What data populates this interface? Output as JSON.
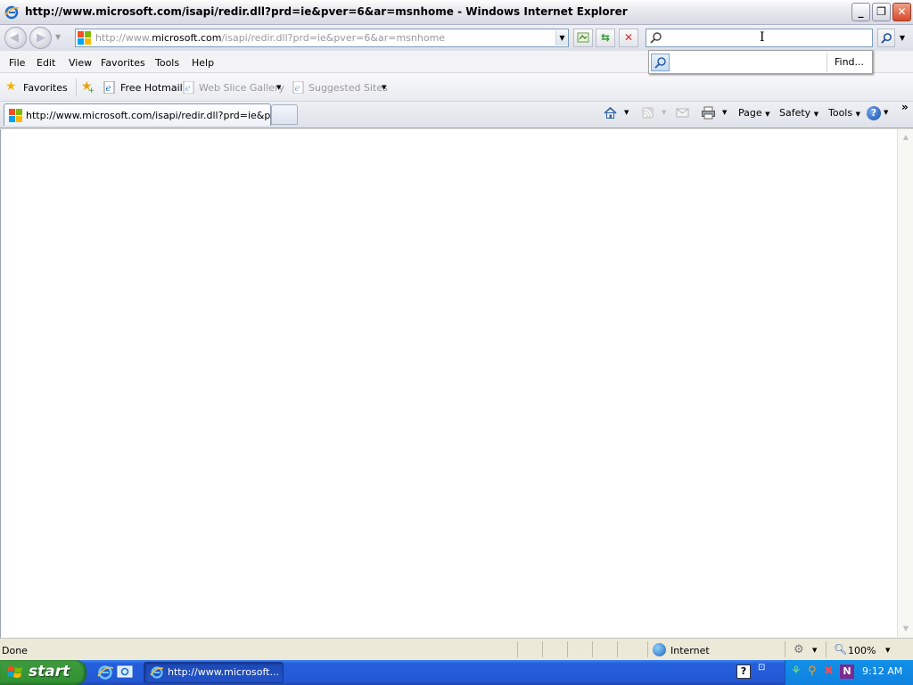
{
  "window": {
    "title": "http://www.microsoft.com/isapi/redir.dll?prd=ie&pver=6&ar=msnhome - Windows Internet Explorer"
  },
  "address": {
    "url_prefix": "http://www.",
    "url_host": "microsoft.com",
    "url_path": "/isapi/redir.dll?prd=ie&pver=6&ar=msnhome"
  },
  "search": {
    "value": "",
    "popup_find": "Find..."
  },
  "menu": {
    "items": [
      "File",
      "Edit",
      "View",
      "Favorites",
      "Tools",
      "Help"
    ]
  },
  "favorites_bar": {
    "favorites_label": "Favorites",
    "links": [
      "Free Hotmail",
      "Web Slice Gallery",
      "Suggested Sites"
    ]
  },
  "tab": {
    "label": "http://www.microsoft.com/isapi/redir.dll?prd=ie&pver..."
  },
  "command_bar": {
    "page": "Page",
    "safety": "Safety",
    "tools": "Tools"
  },
  "status": {
    "text": "Done",
    "zone": "Internet",
    "zoom": "100%"
  },
  "taskbar": {
    "start_label": "start",
    "task_label": "http://www.microsoft...",
    "clock": "9:12 AM"
  },
  "colors": {
    "taskbar_blue": "#245edb",
    "start_green": "#3c9a3c",
    "tray_blue": "#0f82e0"
  }
}
